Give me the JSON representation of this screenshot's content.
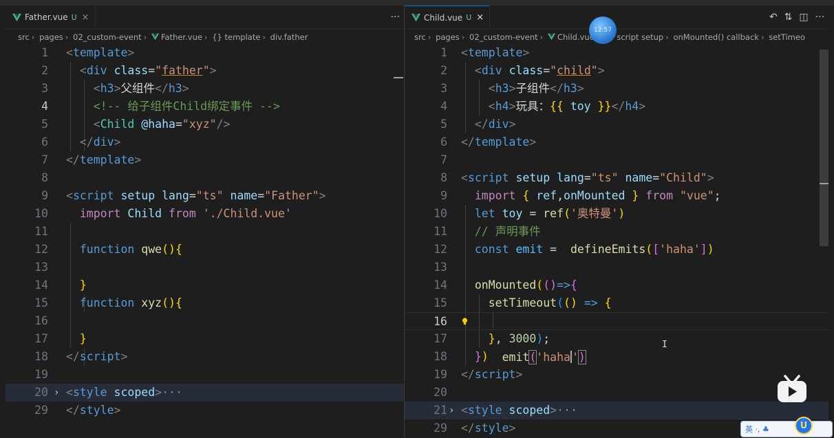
{
  "left": {
    "tab": {
      "name": "Father.vue",
      "status": "U",
      "close": "×"
    },
    "more": "···",
    "breadcrumb": [
      "src",
      "pages",
      "02_custom-event",
      "Father.vue",
      "{} template",
      "div.father"
    ]
  },
  "right": {
    "tab": {
      "name": "Child.vue",
      "status": "U",
      "close": "×"
    },
    "actions": [
      "↶",
      "⇅",
      "◫",
      "···"
    ],
    "breadcrumb": [
      "src",
      "pages",
      "02_custom-event",
      "Child.vue",
      "{} script setup",
      "onMounted() callback",
      "setTimeo"
    ]
  },
  "overlay": {
    "clock_text": "12:57",
    "ime_text": "英 ·, ♣",
    "ime_badge": "U",
    "cursor": "I"
  },
  "colors": {
    "tab_border_active": "#0078d4",
    "untracked": "#73c991",
    "vue_green": "#41b883"
  },
  "icons": [
    "vue-file-icon",
    "close-icon",
    "more-icon",
    "history-icon",
    "compare-icon",
    "split-editor-icon",
    "lightbulb-icon",
    "bilibili-tv-icon"
  ]
}
